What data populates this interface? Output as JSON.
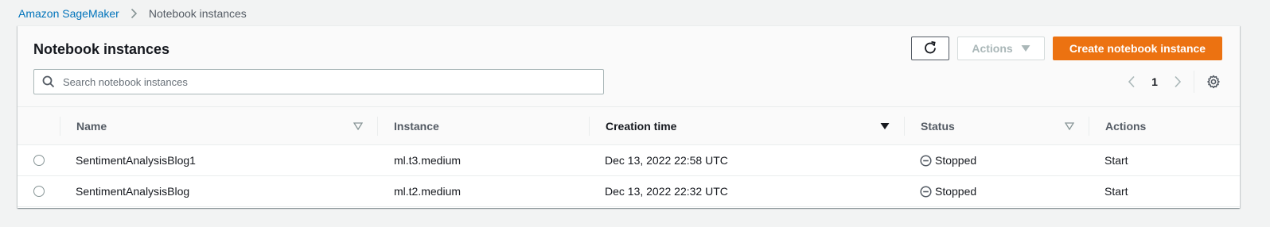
{
  "breadcrumb": {
    "root": "Amazon SageMaker",
    "current": "Notebook instances"
  },
  "panel": {
    "title": "Notebook instances",
    "refresh_icon": "refresh-icon",
    "actions_label": "Actions",
    "create_label": "Create notebook instance",
    "search_placeholder": "Search notebook instances",
    "search_value": "",
    "page_number": "1"
  },
  "table": {
    "columns": {
      "name": "Name",
      "instance": "Instance",
      "creation_time": "Creation time",
      "status": "Status",
      "actions": "Actions"
    },
    "rows": [
      {
        "name": "SentimentAnalysisBlog1",
        "instance": "ml.t3.medium",
        "creation_time": "Dec 13, 2022 22:58 UTC",
        "status": "Stopped",
        "action": "Start"
      },
      {
        "name": "SentimentAnalysisBlog",
        "instance": "ml.t2.medium",
        "creation_time": "Dec 13, 2022 22:32 UTC",
        "status": "Stopped",
        "action": "Start"
      }
    ]
  },
  "colors": {
    "primary": "#ec7211",
    "link": "#0073bb",
    "text": "#16191f",
    "muted": "#545b64",
    "background": "#f2f3f3"
  }
}
